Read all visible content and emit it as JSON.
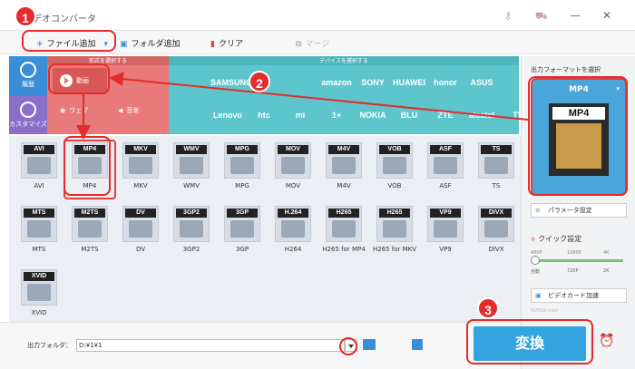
{
  "title_bar": {
    "app_title": "デオコンバータ"
  },
  "toolbar": {
    "add_file": "ファイル追加",
    "add_folder": "フォルダ追加",
    "clear": "クリア",
    "merge": "マージ"
  },
  "nav": {
    "history": "履歴",
    "custom": "カスタマイズ"
  },
  "category": {
    "header": "形式を選択する",
    "video": "動画",
    "web": "ウェブ",
    "music": "音楽"
  },
  "devices": {
    "header": "デバイスを選択する",
    "row1": [
      "",
      "SAMSUNG",
      "G",
      "",
      "amazon",
      "SONY",
      "HUAWEI",
      "honor",
      "ASUS"
    ],
    "row2": [
      "",
      "Lenovo",
      "htc",
      "mi",
      "1+",
      "NOKIA",
      "BLU",
      "ZTE",
      "alcatel",
      "TV"
    ]
  },
  "formats": [
    {
      "tag": "AVI",
      "label": "AVI"
    },
    {
      "tag": "MP4",
      "label": "MP4"
    },
    {
      "tag": "MKV",
      "label": "MKV"
    },
    {
      "tag": "WMV",
      "label": "WMV"
    },
    {
      "tag": "MPG",
      "label": "MPG"
    },
    {
      "tag": "MOV",
      "label": "MOV"
    },
    {
      "tag": "M4V",
      "label": "M4V"
    },
    {
      "tag": "VOB",
      "label": "VOB"
    },
    {
      "tag": "ASF",
      "label": "ASF"
    },
    {
      "tag": "TS",
      "label": "TS"
    },
    {
      "tag": "MTS",
      "label": "MTS"
    },
    {
      "tag": "M2TS",
      "label": "M2TS"
    },
    {
      "tag": "DV",
      "label": "DV"
    },
    {
      "tag": "3GP2",
      "label": "3GP2"
    },
    {
      "tag": "3GP",
      "label": "3GP"
    },
    {
      "tag": "H.264",
      "label": "H264"
    },
    {
      "tag": "H265",
      "label": "H265 for MP4"
    },
    {
      "tag": "H265",
      "label": "H265 for MKV"
    },
    {
      "tag": "VP9",
      "label": "VP9"
    },
    {
      "tag": "DIVX",
      "label": "DIVX"
    },
    {
      "tag": "XVID",
      "label": "XVID"
    }
  ],
  "right_panel": {
    "title": "出力フォーマットを選択",
    "selected_format": "MP4",
    "param_settings": "パラメータ設定",
    "quick_settings": "クイック設定",
    "slider_top": [
      "480P",
      "1080P",
      "4K"
    ],
    "slider_bottom": [
      "自動",
      "720P",
      "2K"
    ],
    "gpu_accel": "ビデオカード加速",
    "gpu_vendors": "NVIDIA   Intel"
  },
  "bottom": {
    "output_label": "出力フォルダ：",
    "output_path": "D:¥1¥1",
    "convert": "変換"
  },
  "annotations": {
    "b1": "1",
    "b2": "2",
    "b3": "3"
  },
  "colors": {
    "accent_blue": "#34a3e0",
    "annotation_red": "#e52b2b",
    "category_red": "#e87a7a",
    "device_teal": "#5cc6cc"
  }
}
